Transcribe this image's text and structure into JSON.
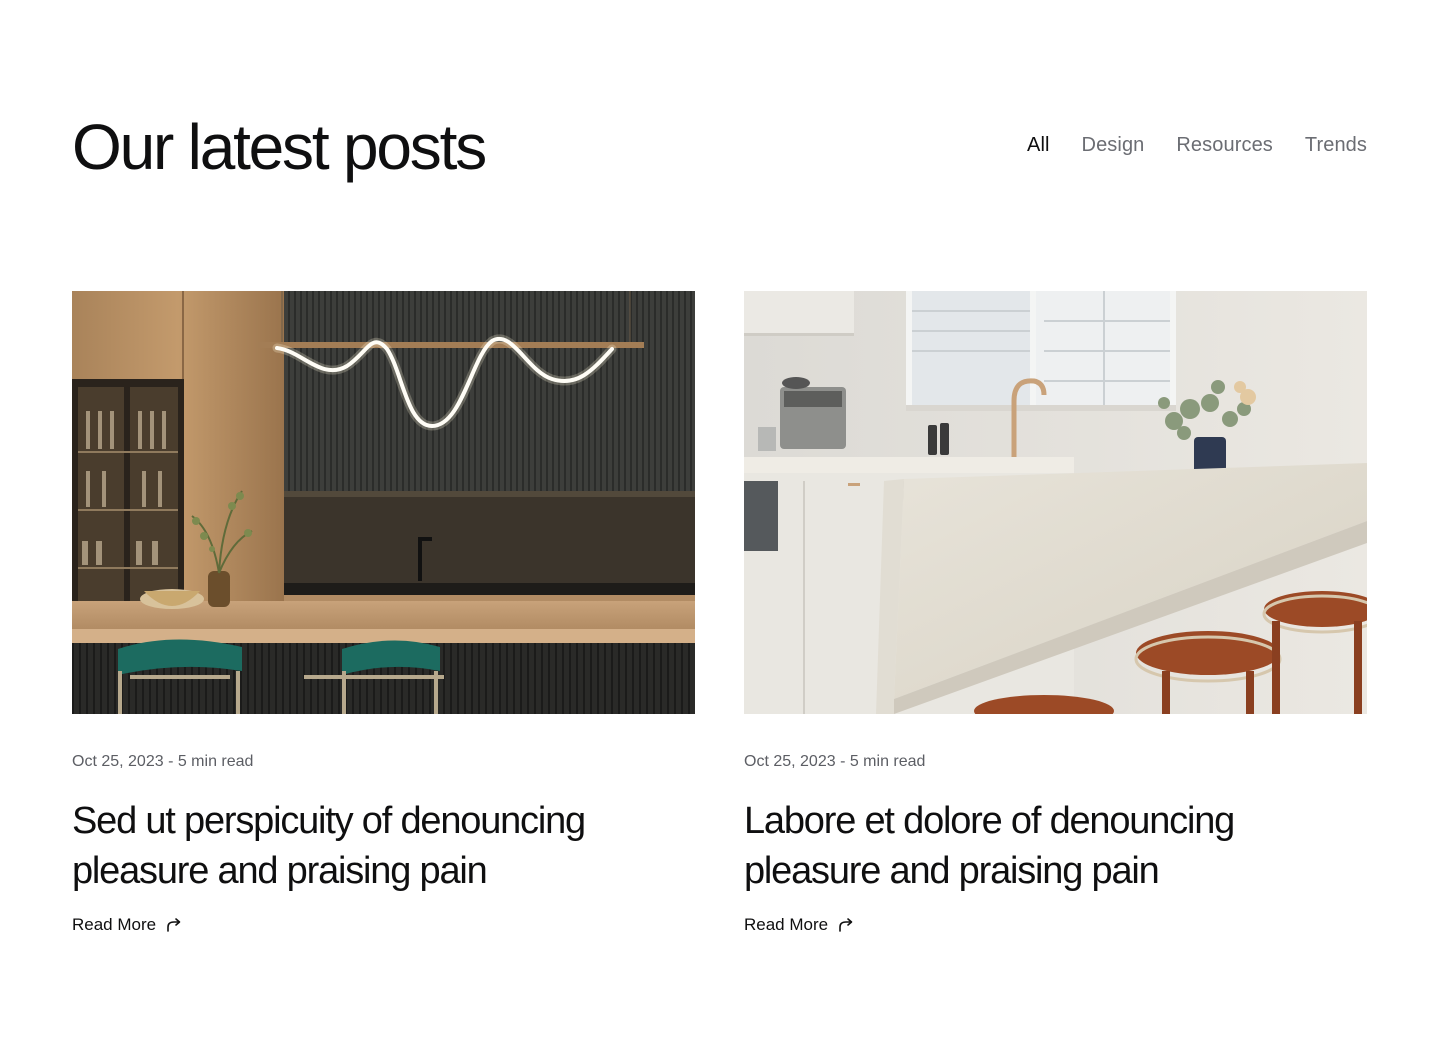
{
  "header": {
    "title": "Our latest posts"
  },
  "filters": [
    {
      "label": "All",
      "active": true
    },
    {
      "label": "Design",
      "active": false
    },
    {
      "label": "Resources",
      "active": false
    },
    {
      "label": "Trends",
      "active": false
    }
  ],
  "posts": [
    {
      "meta": "Oct 25, 2023 - 5 min read",
      "title_line1": "Sed ut perspicuity of denouncing",
      "title_line2": "pleasure and praising pain",
      "read_more": "Read More",
      "image": "dark-kitchen-photo"
    },
    {
      "meta": "Oct 25, 2023 - 5 min read",
      "title_line1": "Labore et dolore of denouncing",
      "title_line2": "pleasure and praising pain",
      "read_more": "Read More",
      "image": "white-kitchen-photo"
    }
  ],
  "icons": {
    "read_more": "curved-arrow-icon"
  }
}
